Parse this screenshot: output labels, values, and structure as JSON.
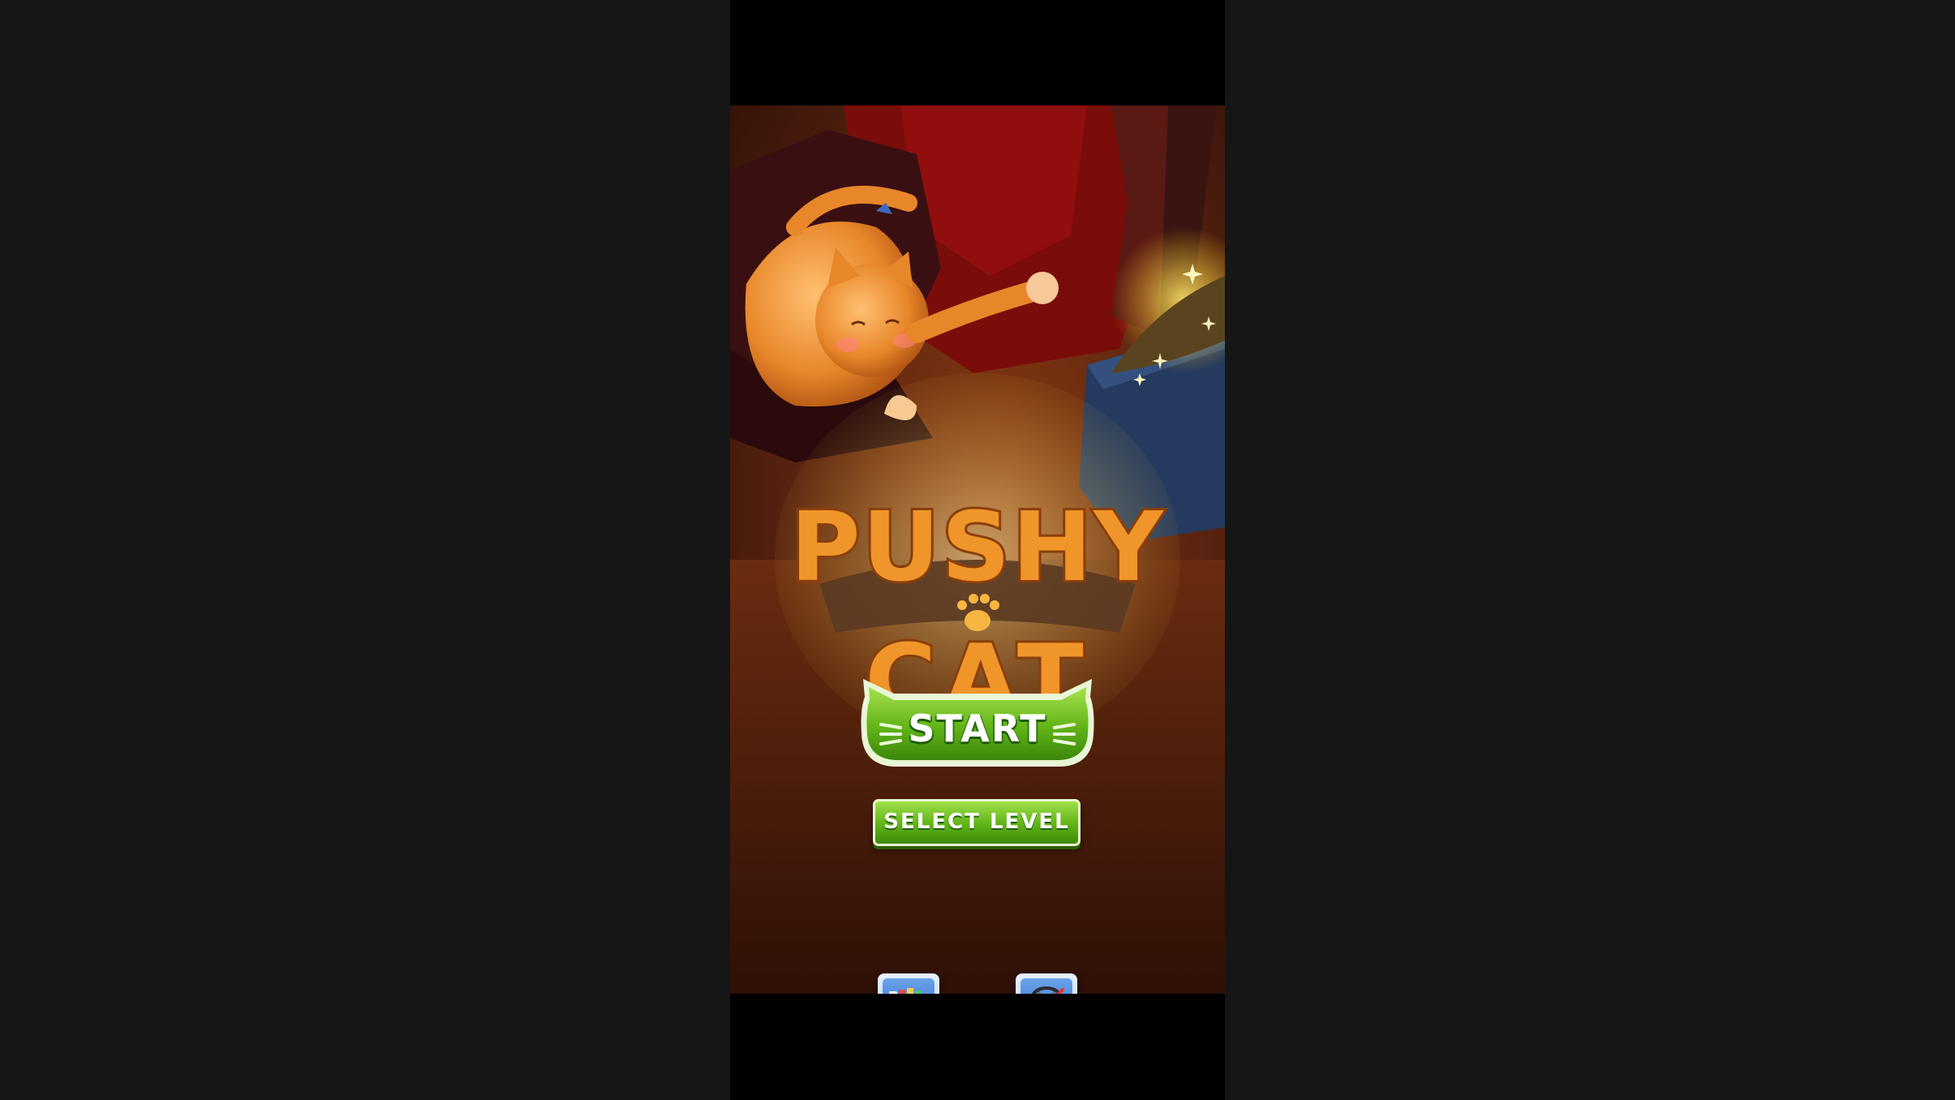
{
  "game": {
    "title_line1": "PUSHY",
    "title_line2": "CAT",
    "start_label": "START",
    "select_level_label": "SELECT LEVEL"
  },
  "icons": {
    "shop": "shopping-cart-icon",
    "sound": "headphones-muted-icon"
  },
  "colors": {
    "background": "#161616",
    "start_green": "#5fb316",
    "title_orange": "#f0952a",
    "icon_blue": "#2f6ac6"
  }
}
